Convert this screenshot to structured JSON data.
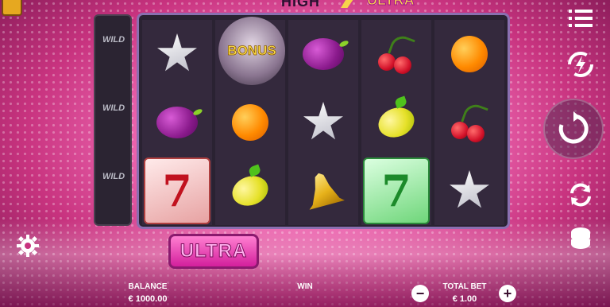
{
  "logo": {
    "left_word": "HIGH",
    "right_word": "ULTRA"
  },
  "wild_column": {
    "labels": [
      "WILD",
      "WILD",
      "WILD"
    ]
  },
  "reels": {
    "bonus_label": "BONUS",
    "seven_symbol": "7"
  },
  "ultra_button": {
    "label": "ULTRA"
  },
  "footer": {
    "balance_label": "BALANCE",
    "balance_value": "€ 1000.00",
    "win_label": "WIN",
    "total_bet_label": "TOTAL BET",
    "total_bet_value": "€ 1.00",
    "minus": "−",
    "plus": "+"
  },
  "icons": {
    "menu": "menu-icon",
    "turbo": "turbo-icon",
    "spin": "spin-icon",
    "autoplay": "autoplay-icon",
    "bet": "coin-stack-icon",
    "settings": "gear-icon"
  },
  "colors": {
    "accent_pink": "#d31f9c",
    "reel_frame": "#8a6fb0"
  }
}
